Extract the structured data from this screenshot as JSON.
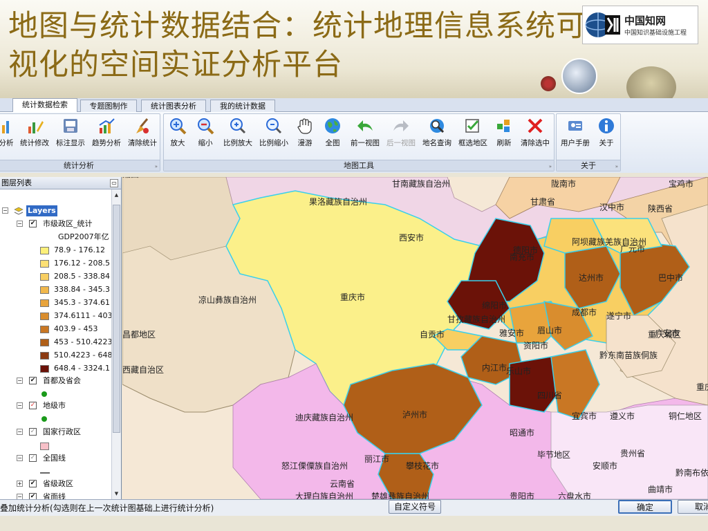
{
  "slide": {
    "title_line1": "地图与统计数据结合：统计地理信息系统可",
    "title_line2": "视化的空间实证分析平台"
  },
  "logo": {
    "brand": "CNKI",
    "name": "中国知网",
    "sub": "中国知识基础设施工程"
  },
  "tabs": [
    "统计数据检索",
    "专题图制作",
    "统计图表分析",
    "我的统计数据"
  ],
  "toolbar": {
    "groups": [
      {
        "label": "统计分析",
        "buttons": [
          "分析",
          "统计修改",
          "标注显示",
          "趋势分析",
          "清除统计"
        ]
      },
      {
        "label": "地图工具",
        "buttons": [
          "放大",
          "缩小",
          "比例放大",
          "比例缩小",
          "漫游",
          "全图",
          "前一视图",
          "后一视图",
          "地名查询",
          "框选地区",
          "刷新",
          "清除选中"
        ]
      },
      {
        "label": "关于",
        "buttons": [
          "用户手册",
          "关于"
        ]
      }
    ]
  },
  "layers_panel": {
    "title": "图层列表",
    "root": "Layers",
    "layer1": "市级政区_统计",
    "field": "GDP2007年亿",
    "legend": [
      {
        "range": "78.9 - 176.12",
        "color": "#fdf07a"
      },
      {
        "range": "176.12 - 208.5",
        "color": "#fde074"
      },
      {
        "range": "208.5 - 338.84",
        "color": "#f8cf62"
      },
      {
        "range": "338.84 - 345.3",
        "color": "#f1b84c"
      },
      {
        "range": "345.3 - 374.61",
        "color": "#e8a43c"
      },
      {
        "range": "374.6111 - 403",
        "color": "#d98d2e"
      },
      {
        "range": "403.9 - 453",
        "color": "#c97724"
      },
      {
        "range": "453 - 510.4223",
        "color": "#b05f18"
      },
      {
        "range": "510.4223 - 648",
        "color": "#8b3a12"
      },
      {
        "range": "648.4 - 3324.1",
        "color": "#6b1208"
      }
    ],
    "layers": [
      "首都及省会",
      "地级市",
      "国家行政区",
      "全国线",
      "省级政区",
      "省面线"
    ]
  },
  "map_labels": {
    "regions": [
      "甘南藏族自治州",
      "果洛藏族自治州",
      "甘肃省",
      "陇南市",
      "汉中市",
      "陕西省",
      "宝鸡市",
      "西安市",
      "阿坝藏族羌族自治州",
      "广元市",
      "巴中市",
      "达州市",
      "南充市",
      "德阳市",
      "绵阳市",
      "成都市",
      "遂宁市",
      "广安市",
      "重庆市",
      "甘孜藏族自治州",
      "雅安市",
      "眉山市",
      "资阳市",
      "内江市",
      "乐山市",
      "自贡市",
      "四川省",
      "宜宾市",
      "泸州市",
      "凉山彝族自治州",
      "昌都地区",
      "西藏自治区",
      "迪庆藏族自治州",
      "丽江市",
      "攀枝花市",
      "怒江傈僳族自治州",
      "云南省",
      "大理白族自治州",
      "楚雄彝族自治州",
      "昭通市",
      "毕节地区",
      "贵州省",
      "遵义市",
      "铜仁地区",
      "六盘水市",
      "安顺市",
      "贵阳市",
      "曲靖市",
      "黔南布依族苗族自治州",
      "黔东南苗族侗族",
      "重庆城区",
      "重庆郊县",
      "湘西"
    ]
  },
  "statusbar": {
    "text": "叠加统计分析(勾选则在上一次统计图基础上进行统计分析)",
    "custom_symbol": "自定义符号",
    "ok": "确定",
    "cancel": "取消"
  },
  "colors": {
    "title": "#8b6a16",
    "yellow_region": "#fbf08a",
    "pink_region": "#f2b6e8",
    "border_cyan": "#3fd2ee"
  }
}
